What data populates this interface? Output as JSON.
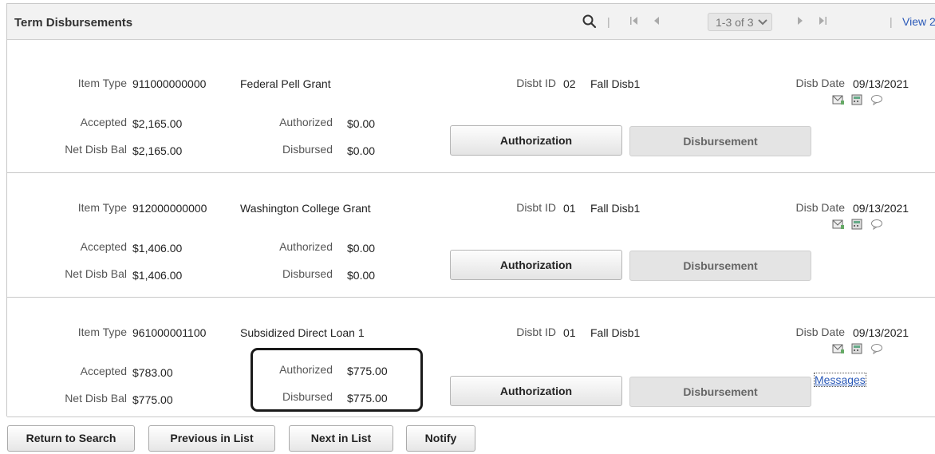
{
  "header": {
    "title": "Term Disbursements",
    "pager_label": "1-3 of 3",
    "view_link": "View 2",
    "separator": "|"
  },
  "labels": {
    "item_type": "Item Type",
    "disbt_id": "Disbt ID",
    "disb_date": "Disb Date",
    "accepted": "Accepted",
    "authorized": "Authorized",
    "net_disb_bal": "Net Disb Bal",
    "disbursed": "Disbursed"
  },
  "buttons": {
    "authorization": "Authorization",
    "disbursement": "Disbursement"
  },
  "rows": [
    {
      "item_type_code": "911000000000",
      "item_type_desc": "Federal Pell Grant",
      "disbt_id": "02",
      "disbt_desc": "Fall Disb1",
      "disb_date": "09/13/2021",
      "accepted": "$2,165.00",
      "authorized": "$0.00",
      "net_disb_bal": "$2,165.00",
      "disbursed": "$0.00"
    },
    {
      "item_type_code": "912000000000",
      "item_type_desc": "Washington College Grant",
      "disbt_id": "01",
      "disbt_desc": "Fall Disb1",
      "disb_date": "09/13/2021",
      "accepted": "$1,406.00",
      "authorized": "$0.00",
      "net_disb_bal": "$1,406.00",
      "disbursed": "$0.00"
    },
    {
      "item_type_code": "961000001100",
      "item_type_desc": "Subsidized Direct Loan 1",
      "disbt_id": "01",
      "disbt_desc": "Fall Disb1",
      "disb_date": "09/13/2021",
      "accepted": "$783.00",
      "authorized": "$775.00",
      "net_disb_bal": "$775.00",
      "disbursed": "$775.00",
      "messages_link": "Messages"
    }
  ],
  "footer": {
    "return_to_search": "Return to Search",
    "previous_in_list": "Previous in List",
    "next_in_list": "Next in List",
    "notify": "Notify"
  },
  "icons": [
    "search-icon",
    "first-page-icon",
    "previous-page-icon",
    "chevron-down-icon",
    "next-page-icon",
    "last-page-icon",
    "mail-icon",
    "calculator-icon",
    "comment-icon"
  ],
  "colors": {
    "link": "#2a59b8",
    "header_bg": "#f2f2f2",
    "highlight_border": "#1a1a1a"
  }
}
